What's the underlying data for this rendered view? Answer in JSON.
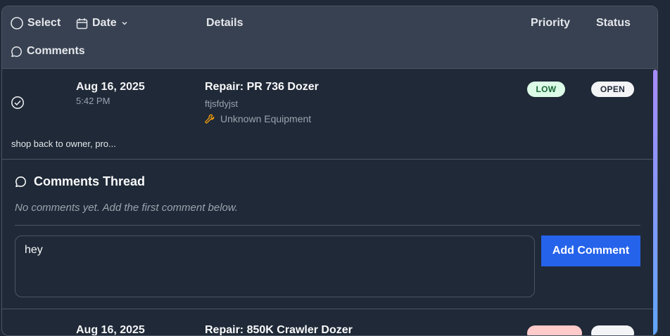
{
  "header": {
    "select_label": "Select",
    "date_label": "Date",
    "details_label": "Details",
    "priority_label": "Priority",
    "status_label": "Status",
    "comments_label": "Comments"
  },
  "rows": [
    {
      "date": "Aug 16, 2025",
      "time": "5:42 PM",
      "title": "Repair: PR 736 Dozer",
      "subtitle": "ftjsfdyjst",
      "equipment": "Unknown Equipment",
      "priority": "LOW",
      "status": "OPEN",
      "comment_snippet": "shop back to owner, pro..."
    },
    {
      "date": "Aug 16, 2025",
      "title": "Repair: 850K Crawler Dozer"
    }
  ],
  "thread": {
    "title": "Comments Thread",
    "empty_text": "No comments yet. Add the first comment below.",
    "input_value": "hey",
    "add_button_label": "Add Comment"
  },
  "colors": {
    "accent": "#2563eb",
    "low_bg": "#dcfce7",
    "low_text": "#166534",
    "open_bg": "#f3f4f6",
    "wrench": "#f59e0b"
  }
}
